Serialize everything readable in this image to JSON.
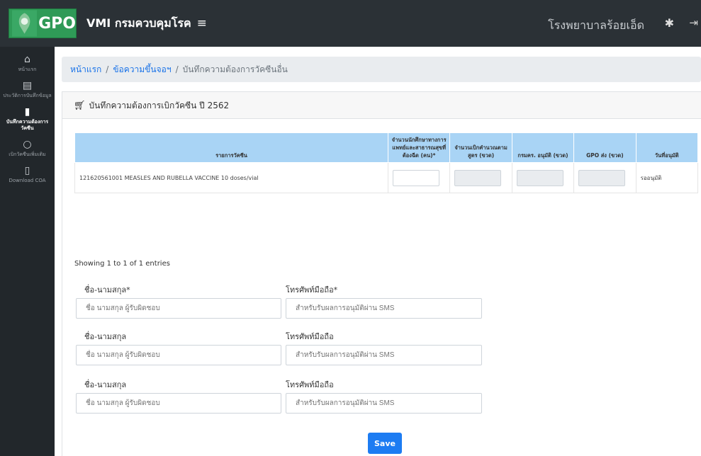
{
  "header": {
    "logo_text": "GPO",
    "app_title": "VMI กรมควบคุมโรค",
    "menu_icon": "hamburger-icon",
    "hospital": "โรงพยาบาลร้อยเอ็ด",
    "settings_icon": "gear-icon",
    "logout_icon": "logout-icon"
  },
  "sidebar": {
    "items": [
      {
        "icon": "home-icon",
        "glyph": "⌂",
        "label": "หน้าแรก",
        "active": false
      },
      {
        "icon": "list-icon",
        "glyph": "▤",
        "label": "ประวัติการบันทึกข้อมูล",
        "active": false
      },
      {
        "icon": "clipboard-icon",
        "glyph": "▮",
        "label": "บันทึกความต้องการวัคซีน",
        "active": true
      },
      {
        "icon": "circle-icon",
        "glyph": "○",
        "label": "เบิกวัคซีนเพิ่มเติม",
        "active": false
      },
      {
        "icon": "download-icon",
        "glyph": "▯",
        "label": "Download COA",
        "active": false
      }
    ]
  },
  "breadcrumb": {
    "home": "หน้าแรก",
    "messages": "ข้อความขึ้นจอฯ",
    "current": "บันทึกความต้องการวัคซีนอื่น"
  },
  "card": {
    "icon": "cart-icon",
    "title": "บันทึกความต้องการเบิกวัคซีน ปี 2562"
  },
  "table": {
    "columns": [
      "รายการวัคซีน",
      "จำนวนนักศึกษาทางการแพทย์และสาธารณสุขที่ต้องฉีด (คน)*",
      "จำนวนเบิกคำนวณตามสูตร (ขวด)",
      "กรมคร. อนุมัติ (ขวด)",
      "GPO ส่ง (ขวด)",
      "วันที่อนุมัติ"
    ],
    "rows": [
      {
        "vaccine": "121620561001 MEASLES AND RUBELLA VACCINE 10 doses/vial",
        "students": "",
        "calc": "",
        "approved": "",
        "gpo": "",
        "status": "รออนุมัติ"
      }
    ]
  },
  "showing": "Showing 1 to 1 of 1 entries",
  "contacts": [
    {
      "name_label": "ชื่อ-นามสกุล*",
      "name_placeholder": "ชื่อ นามสกุล ผู้รับผิดชอบ",
      "phone_label": "โทรศัพท์มือถือ*",
      "phone_placeholder": "สำหรับรับผลการอนุมัติผ่าน SMS"
    },
    {
      "name_label": "ชื่อ-นามสกุล",
      "name_placeholder": "ชื่อ นามสกุล ผู้รับผิดชอบ",
      "phone_label": "โทรศัพท์มือถือ",
      "phone_placeholder": "สำหรับรับผลการอนุมัติผ่าน SMS"
    },
    {
      "name_label": "ชื่อ-นามสกุล",
      "name_placeholder": "ชื่อ นามสกุล ผู้รับผิดชอบ",
      "phone_label": "โทรศัพท์มือถือ",
      "phone_placeholder": "สำหรับรับผลการอนุมัติผ่าน SMS"
    }
  ],
  "save_label": "Save",
  "colors": {
    "topbar": "#2b3136",
    "sidebar": "#22272b",
    "table_header": "#a9d4f5",
    "primary": "#1d7cf2",
    "logo_green": "#2f9a57"
  }
}
